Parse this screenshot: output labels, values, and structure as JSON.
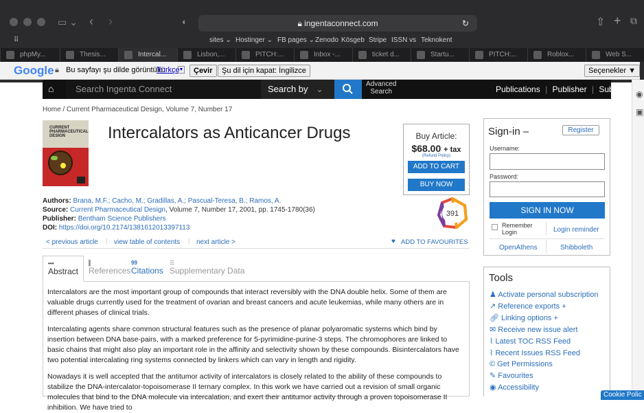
{
  "browser": {
    "url": "ingentaconnect.com",
    "bookmarks": [
      "sites ⌄",
      "Hostinger ⌄",
      "FB pages ⌄",
      "Zenodo",
      "Kösgeb",
      "Stripe",
      "ISSN vs",
      "Teknokent"
    ],
    "tabs": [
      "phpMy...",
      "Thesis...",
      "Intercal...",
      "Lisbon,...",
      "PITCH:...",
      "Inbox -...",
      "ticket d...",
      "Startu...",
      "PITCH:...",
      "Roblox...",
      "Web S..."
    ]
  },
  "translate": {
    "logo": "Google",
    "prompt": "Bu sayfayı şu dilde görüntüle:",
    "lang": "Türkçe",
    "translate_btn": "Çevir",
    "disable_btn": "Şu dil için kapat: İngilizce",
    "options_btn": "Seçenekler ▼"
  },
  "nav": {
    "search_placeholder": "Search Ingenta Connect",
    "search_by": "Search by",
    "advanced": "Advanced",
    "advanced2": "Search",
    "publications": "Publications",
    "publisher": "Publisher",
    "subjects": "Subjects"
  },
  "breadcrumb": {
    "home": "Home",
    "journal": "Current Pharmaceutical Design",
    "rest": ", Volume 7, Number 17"
  },
  "cover": {
    "l1": "CURRENT",
    "l2": "PHARMACEUTICAL",
    "l3": "DESIGN"
  },
  "article": {
    "title": "Intercalators as Anticancer Drugs",
    "authors_label": "Authors:",
    "authors": "Brana, M.F.; Cacho, M.; Gradillas, A.; Pascual-Teresa, B.; Ramos, A.",
    "source_label": "Source:",
    "source_journal": "Current Pharmaceutical Design",
    "source_rest": ", Volume 7, Number 17, 2001, pp. 1745-1780(36)",
    "publisher_label": "Publisher:",
    "publisher": "Bentham Science Publishers",
    "doi_label": "DOI:",
    "doi": "https://doi.org/10.2174/1381612013397113"
  },
  "buy": {
    "label": "Buy Article:",
    "price": "$68.00",
    "tax": "+ tax",
    "refund": "(Refund Policy)",
    "add_cart": "ADD TO CART",
    "buy_now": "BUY NOW"
  },
  "altmetric": {
    "score": "391"
  },
  "artnav": {
    "prev": "< previous article",
    "toc": "view table of contents",
    "next": "next article >",
    "fav": "ADD TO FAVOURITES"
  },
  "content_tabs": [
    {
      "icon": "•••",
      "label": "Abstract"
    },
    {
      "icon": "▌",
      "label": "References"
    },
    {
      "icon": "99",
      "label": "Citations"
    },
    {
      "icon": "☰",
      "label": "Supplementary Data"
    }
  ],
  "abstract": {
    "p1": "Intercalators are the most important group of compounds that interact reversibly with the DNA double helix. Some of them are valuable drugs currently used for the treatment of ovarian and breast cancers and acute leukemias, while many others are in different phases of clinical trials.",
    "p2": "Intercalating agents share common structural features such as the presence of planar polyaromatic systems which bind by insertion between DNA base-pairs, with a marked preference for 5-pyrimidine-purine-3 steps. The chromophores are linked to basic chains that might also play an important role in the affinity and selectivity shown by these compounds. Bisintercalators have two potential intercalating ring systems connected by linkers which can vary in length and rigidity.",
    "p3": "Nowadays it is well accepted that the antitumor activity of intercalators is closely related to the ability of these compounds to stabilize the DNA-intercalator-topoisomerase II ternary complex. In this work we have carried out a revision of small organic molecules that bind to the DNA molecule via intercalation, and exert their antitumor activity through a proven topoisomerase II inhibition. We have tried to"
  },
  "signin": {
    "title": "Sign-in –",
    "register": "Register",
    "username": "Username:",
    "password": "Password:",
    "submit": "SIGN IN NOW",
    "remember": "Remember Login",
    "reminder": "Login reminder",
    "openathens": "OpenAthens",
    "shibboleth": "Shibboleth"
  },
  "tools": {
    "title": "Tools",
    "items": [
      "Activate personal subscription",
      "Reference exports +",
      "Linking options +",
      "Receive new issue alert",
      "Latest TOC RSS Feed",
      "Recent Issues RSS Feed",
      "Get Permissions",
      "Favourites",
      "Accessibility"
    ]
  },
  "cookie": "Cookie Polic"
}
